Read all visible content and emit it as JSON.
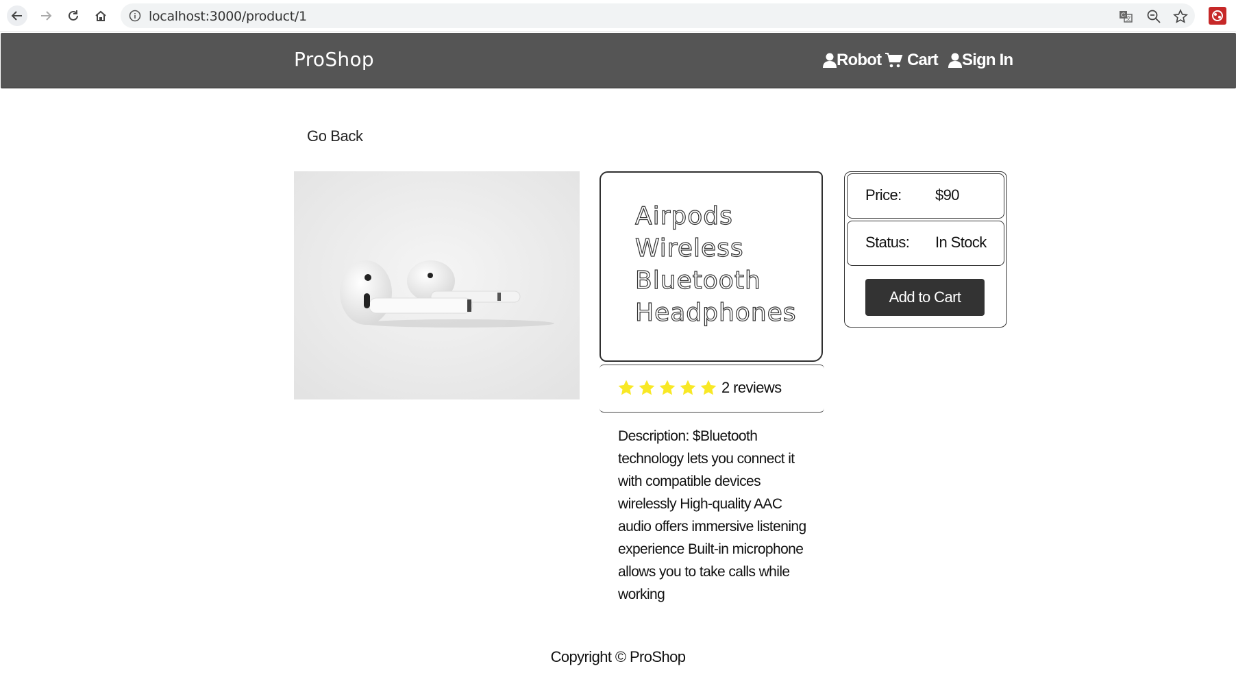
{
  "browser": {
    "url": "localhost:3000/product/1",
    "back_icon": "arrow-left-icon",
    "forward_icon": "arrow-right-icon",
    "reload_icon": "reload-icon",
    "home_icon": "home-icon",
    "info_icon": "info-icon",
    "translate_icon": "translate-icon",
    "zoom_icon": "zoom-out-icon",
    "bookmark_icon": "star-outline-icon",
    "extension_icon": "extension-icon"
  },
  "navbar": {
    "brand": "ProShop",
    "user_label": "Robot",
    "cart_label": "Cart",
    "signin_label": "Sign In"
  },
  "page": {
    "go_back": "Go Back"
  },
  "product": {
    "title": "Airpods Wireless Bluetooth Headphones",
    "rating": 5,
    "reviews_text": "2 reviews",
    "description": "Description: $Bluetooth technology lets you connect it with compatible devices wirelessly High-quality AAC audio offers immersive listening experience Built-in microphone allows you to take calls while working"
  },
  "buy_box": {
    "price_label": "Price:",
    "price_value": "$90",
    "status_label": "Status:",
    "status_value": "In Stock",
    "add_to_cart": "Add to Cart"
  },
  "footer": {
    "copyright": "Copyright © ProShop"
  },
  "colors": {
    "navbar": "#555555",
    "button": "#333333",
    "star": "#f8e825"
  }
}
